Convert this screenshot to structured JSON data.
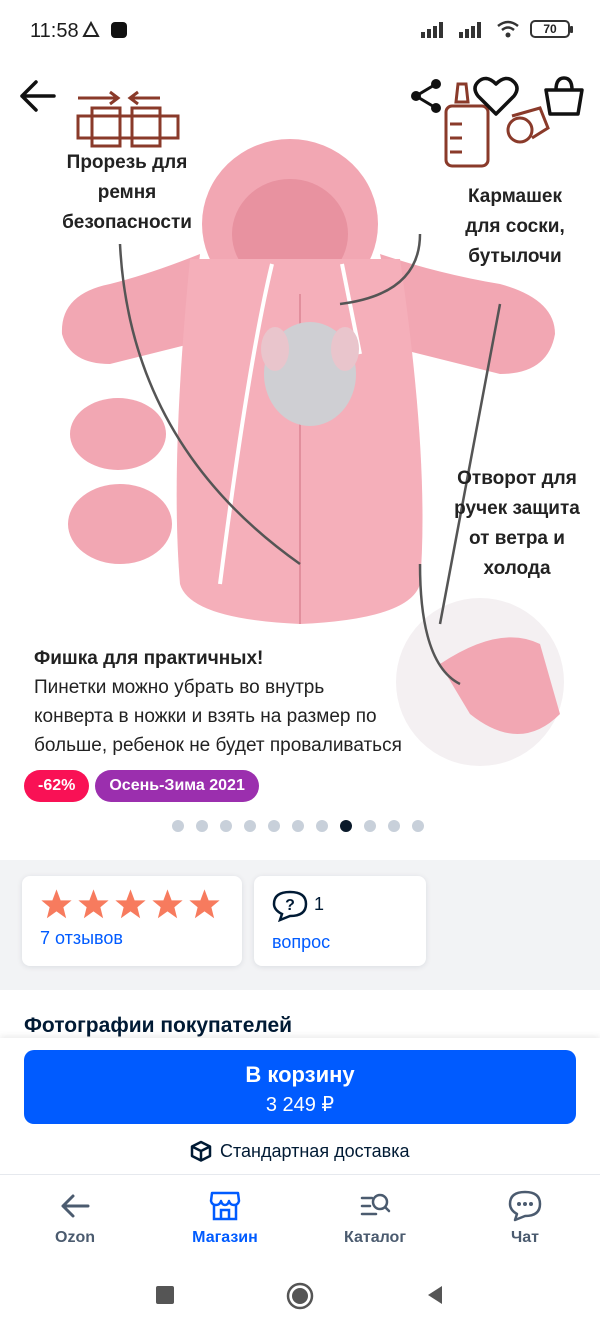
{
  "status_bar": {
    "time": "11:58",
    "battery": "70",
    "icons": [
      "no-sim-warning-icon",
      "notification-square-icon",
      "signal-icon",
      "signal-icon",
      "wifi-icon",
      "battery-icon"
    ]
  },
  "product_image": {
    "callouts": {
      "belt_slot": "Прорезь для ремня безопасности",
      "pocket": "Кармашек для соски, бутылочи",
      "cuffs": "Отворот для ручек защита от ветра и холода"
    },
    "tip_title": "Фишка для практичных!",
    "tip_text": "Пинетки можно убрать во внутрь конверта в ножки и взять на размер по больше, ребенок не будет проваливаться",
    "colors": {
      "suit": "#f2a7b3",
      "accent": "#8a3a2a"
    }
  },
  "header_actions": {
    "icons": [
      "back-arrow-icon",
      "share-icon",
      "heart-icon",
      "shopping-bag-icon"
    ]
  },
  "badges": {
    "discount": "-62%",
    "season": "Осень-Зима 2021",
    "discount_color": "#f91155",
    "season_color": "#9b2fae"
  },
  "gallery": {
    "total_images": 11,
    "active_index": 7
  },
  "rating_card": {
    "stars": 5,
    "reviews_link": "7 отзывов",
    "star_color": "#f77b5e"
  },
  "question_card": {
    "count": "1",
    "link": "вопрос"
  },
  "photos_section": {
    "title": "Фотографии покупателей"
  },
  "cart": {
    "button_label": "В корзину",
    "price": "3 249 ₽",
    "delivery": "Стандартная доставка",
    "button_color": "#005bff"
  },
  "bottom_nav": {
    "items": [
      {
        "label": "Ozon",
        "icon": "back-arrow-icon"
      },
      {
        "label": "Магазин",
        "icon": "store-icon",
        "active": true
      },
      {
        "label": "Каталог",
        "icon": "catalog-search-icon"
      },
      {
        "label": "Чат",
        "icon": "chat-icon"
      }
    ]
  }
}
